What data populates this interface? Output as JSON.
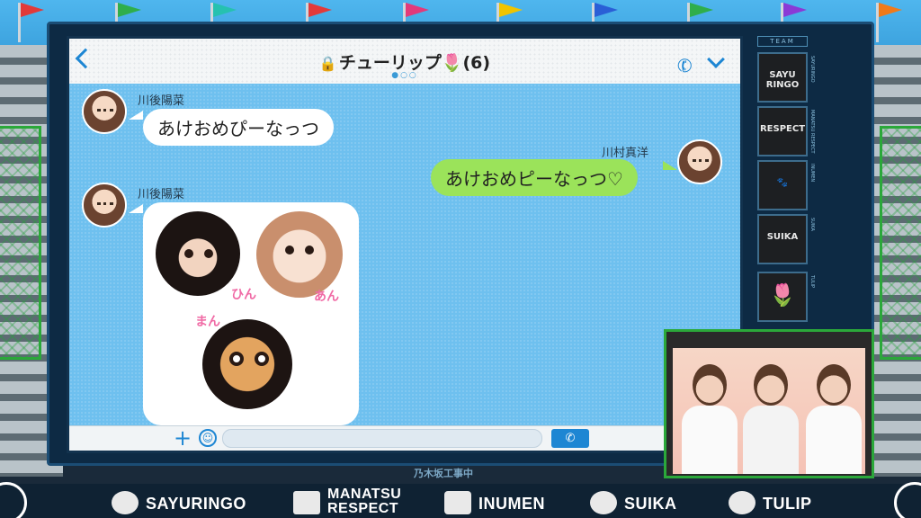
{
  "chat": {
    "title": "チューリップ",
    "member_count": "(6)",
    "messages": [
      {
        "sender": "川後陽菜",
        "text": "あけおめぴーなっつ"
      },
      {
        "sender": "川村真洋",
        "text": "あけおめピーなっつ♡"
      },
      {
        "sender": "川後陽菜",
        "stickers": [
          "ひん",
          "あん",
          "まん"
        ]
      }
    ]
  },
  "team_panel": {
    "title": "TEAM",
    "teams": [
      "SAYURINGO",
      "MANATSU RESPECT",
      "INUMEN",
      "SUIKA",
      "TULIP"
    ],
    "tile_labels": [
      "SAYU RINGO",
      "RESPECT",
      "🐾",
      "SUIKA",
      "🌷"
    ]
  },
  "banner": {
    "logo": "乃木坂工事中",
    "teams": [
      "SAYURINGO",
      "MANATSU RESPECT",
      "INUMEN",
      "SUIKA",
      "TULIP"
    ]
  },
  "colors": {
    "chat_bg": "#6ec0ef",
    "accent": "#1d86d3",
    "green_bubble": "#9be35a",
    "tulip": "#ff8a1f"
  },
  "icons": [
    "back-chevron-icon",
    "lock-icon",
    "tulip-icon",
    "phone-icon",
    "chevron-down-icon",
    "plus-icon",
    "smiley-icon",
    "send-icon"
  ]
}
